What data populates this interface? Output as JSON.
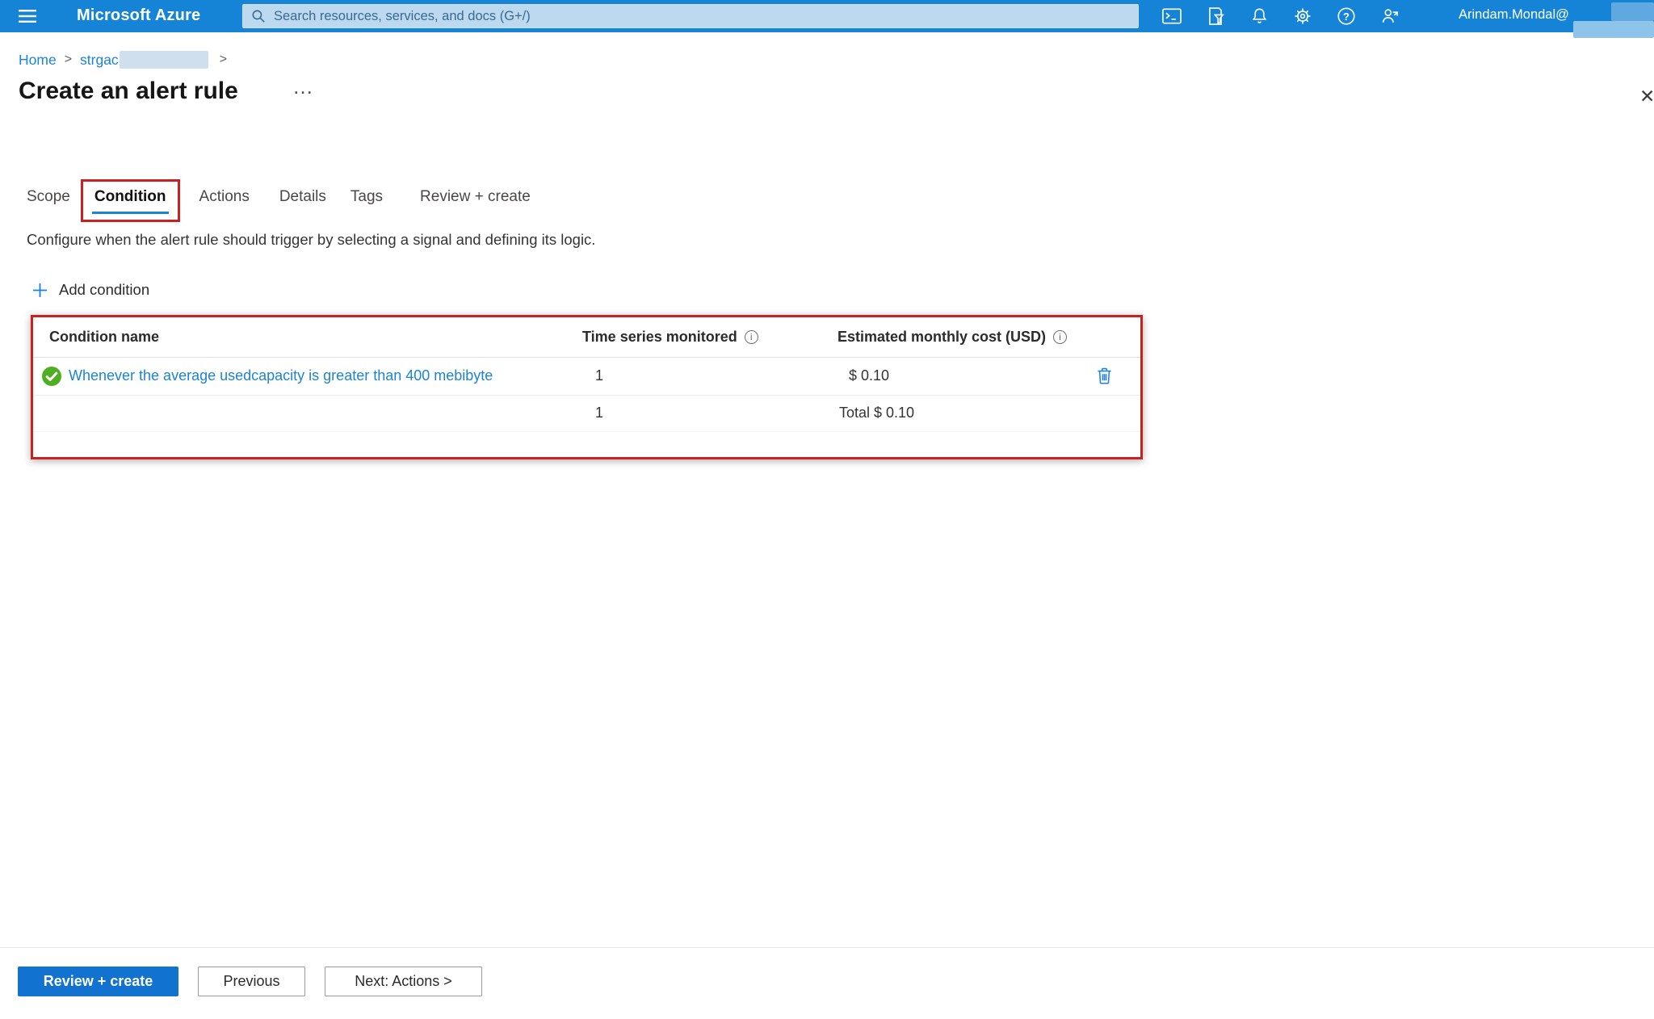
{
  "colors": {
    "topbar_bg": "#1583d6",
    "accent_blue": "#1b83d8",
    "annotation_red": "#c8211f",
    "success_green": "#4fae21",
    "primary_button_bg": "#1172cf",
    "search_box_bg": "#bcd9ef"
  },
  "topbar": {
    "brand": "Microsoft Azure",
    "search_placeholder": "Search resources, services, and docs (G+/)",
    "user_name": "Arindam.Mondal@",
    "help_glyph": "?"
  },
  "breadcrumb": {
    "home": "Home",
    "resource": "strgac",
    "separator": ">"
  },
  "page": {
    "title": "Create an alert rule",
    "more_icon": "…",
    "close_icon": "✕",
    "description": "Configure when the alert rule should trigger by selecting a signal and defining its logic."
  },
  "tabs": [
    "Scope",
    "Condition",
    "Actions",
    "Details",
    "Tags",
    "Review + create"
  ],
  "add_condition_label": "Add condition",
  "table": {
    "info_icon": "i",
    "headers": {
      "name": "Condition name",
      "time_series": "Time series monitored",
      "cost": "Estimated monthly cost (USD)"
    },
    "rows": [
      {
        "name": "Whenever the average usedcapacity is greater than 400 mebibyte",
        "time_series": "1",
        "cost": "$ 0.10"
      }
    ],
    "total_row": {
      "time_series": "1",
      "cost": "Total $ 0.10"
    }
  },
  "footer": {
    "review_create": "Review + create",
    "previous": "Previous",
    "next_actions": "Next: Actions >"
  }
}
